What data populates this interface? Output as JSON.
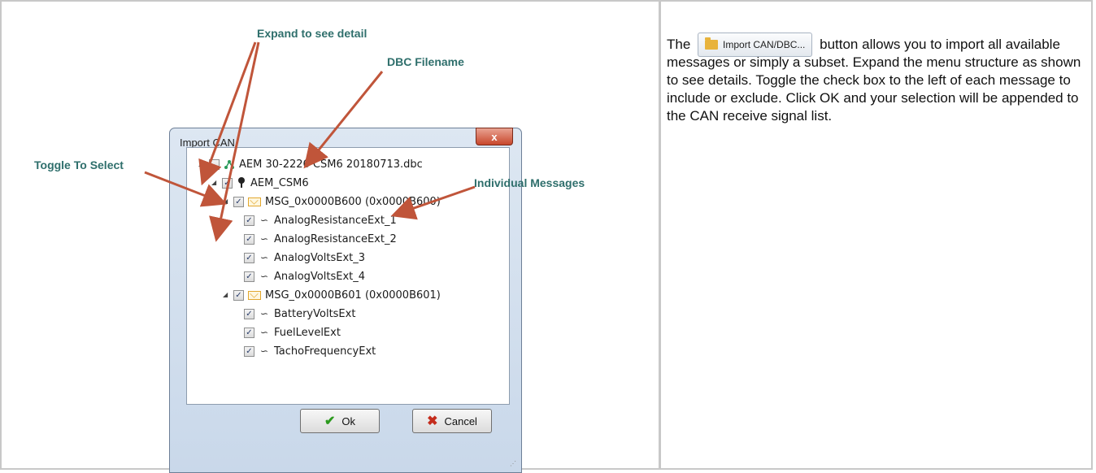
{
  "annotations": {
    "expand": "Expand to see detail",
    "dbc_filename": "DBC Filename",
    "toggle": "Toggle To Select",
    "individual": "Individual Messages"
  },
  "colors": {
    "annotation": "#2f6f6c",
    "arrow": "#c0553a"
  },
  "dialog": {
    "title": "Import CAN",
    "close_label": "x",
    "ok_label": "Ok",
    "cancel_label": "Cancel",
    "tree": [
      {
        "label": "AEM 30-2226 CSM6 20180713.dbc",
        "icon": "network-icon",
        "checked": false
      },
      {
        "label": "AEM_CSM6",
        "icon": "node-icon",
        "checked": true
      },
      {
        "label": "MSG_0x0000B600 (0x0000B600)",
        "icon": "envelope-icon",
        "checked": true
      },
      {
        "label": "AnalogResistanceExt_1",
        "icon": "signal-icon",
        "checked": true
      },
      {
        "label": "AnalogResistanceExt_2",
        "icon": "signal-icon",
        "checked": true
      },
      {
        "label": "AnalogVoltsExt_3",
        "icon": "signal-icon",
        "checked": true
      },
      {
        "label": "AnalogVoltsExt_4",
        "icon": "signal-icon",
        "checked": true
      },
      {
        "label": "MSG_0x0000B601 (0x0000B601)",
        "icon": "envelope-icon",
        "checked": true
      },
      {
        "label": "BatteryVoltsExt",
        "icon": "signal-icon",
        "checked": true
      },
      {
        "label": "FuelLevelExt",
        "icon": "signal-icon",
        "checked": true
      },
      {
        "label": "TachoFrequencyExt",
        "icon": "signal-icon",
        "checked": true
      }
    ]
  },
  "description": {
    "prefix": "The",
    "button_label": "Import CAN/DBC...",
    "suffix": "button allows you to import all available messages or simply a subset.  Expand the menu structure as shown to see details.  Toggle the check box to the left of each message to include or exclude.  Click OK and your selection will be appended to the CAN receive signal list."
  }
}
